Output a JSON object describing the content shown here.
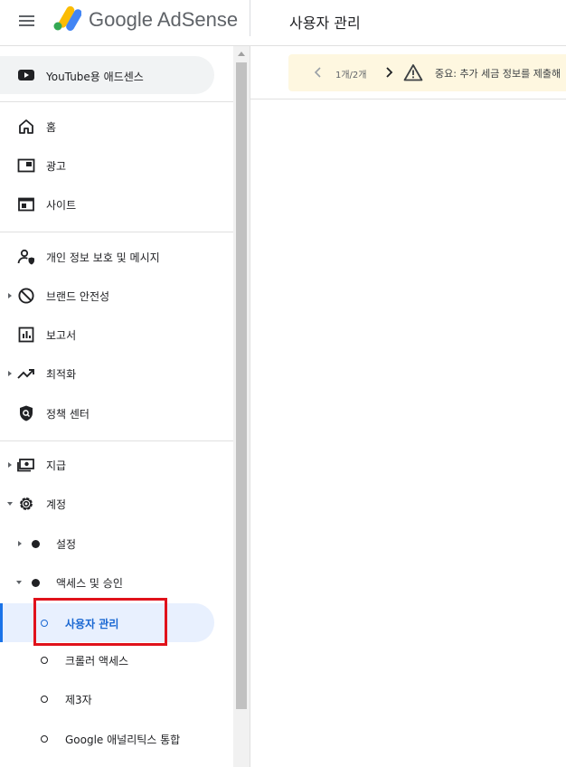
{
  "header": {
    "brand": "Google AdSense",
    "page_title": "사용자 관리"
  },
  "alert": {
    "count": "1개/2개",
    "message": "중요: 추가 세금 정보를 제출해"
  },
  "sidebar": {
    "youtube": "YouTube용 애드센스",
    "home": "홈",
    "ads": "광고",
    "sites": "사이트",
    "privacy": "개인 정보 보호 및 메시지",
    "brand_safety": "브랜드 안전성",
    "reports": "보고서",
    "optimization": "최적화",
    "policy": "정책 센터",
    "payments": "지급",
    "account": "계정",
    "settings": "설정",
    "access": "액세스 및 승인",
    "user_management": "사용자 관리",
    "crawler_access": "크롤러 액세스",
    "third_party": "제3자",
    "analytics": "Google 애널리틱스 통합"
  },
  "colors": {
    "accent": "#1a73e8",
    "active_bg": "#e8f0fe",
    "highlight_box": "#e0121b",
    "alert_bg": "#fef7e0"
  }
}
